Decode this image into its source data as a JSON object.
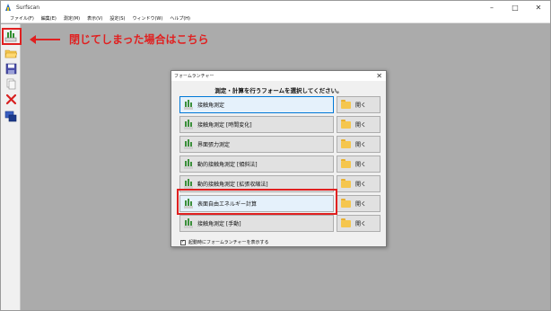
{
  "window": {
    "title": "Surfscan",
    "controls": [
      "–",
      "□",
      "✕"
    ]
  },
  "menubar": {
    "items": [
      "ファイル(F)",
      "編集(E)",
      "測定(M)",
      "表示(V)",
      "設定(S)",
      "ウィンドウ(W)",
      "ヘルプ(H)"
    ]
  },
  "toolbar": {
    "tools": [
      "form-launcher-icon",
      "open-folder-icon",
      "save-icon",
      "copy-icon",
      "delete-icon",
      "connect-icon"
    ]
  },
  "annotation": {
    "text": "閉じてしまった場合はこちら",
    "color": "#e02020"
  },
  "dialog": {
    "title": "フォームランチャー",
    "close": "✕",
    "heading": "測定・計算を行うフォームを選択してください。",
    "forms": [
      {
        "label": "接触角測定",
        "open_label": "開く",
        "selected": true
      },
      {
        "label": "接触角測定 [時間変化]",
        "open_label": "開く"
      },
      {
        "label": "界面張力測定",
        "open_label": "開く"
      },
      {
        "label": "動的接触角測定 [傾斜法]",
        "open_label": "開く"
      },
      {
        "label": "動的接触角測定 [拡張収縮法]",
        "open_label": "開く"
      },
      {
        "label": "表面自由エネルギー計算",
        "open_label": "開く",
        "highlighted": true
      },
      {
        "label": "接触角測定 [手動]",
        "open_label": "開く"
      }
    ],
    "startup_checkbox": {
      "label": "起動時にフォームランチャーを表示する",
      "checked": true,
      "mark": "✓"
    }
  }
}
